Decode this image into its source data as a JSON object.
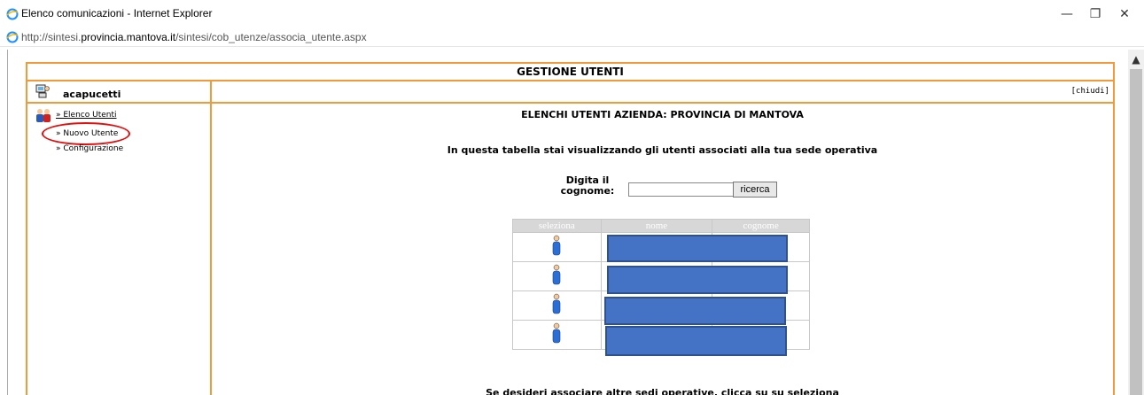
{
  "window": {
    "title": "Elenco comunicazioni - Internet Explorer",
    "url_prefix": "http://sintesi.",
    "url_domain": "provincia.mantova.it",
    "url_path": "/sintesi/cob_utenze/associa_utente.aspx",
    "minimize": "—",
    "restore": "❐",
    "close": "✕"
  },
  "page": {
    "title": "GESTIONE UTENTI",
    "username": "acapucetti",
    "close_link": "[chiudi]",
    "nav": [
      {
        "label": "» Elenco Utenti"
      },
      {
        "label": "» Nuovo Utente"
      },
      {
        "label": "» Configurazione"
      }
    ],
    "heading": "ELENCHI UTENTI AZIENDA: PROVINCIA DI MANTOVA",
    "info": "In questa tabella stai visualizzando gli utenti associati alla tua sede operativa",
    "search_label": "Digita il cognome:",
    "search_button": "ricerca",
    "table": {
      "headers": [
        "seleziona",
        "nome",
        "cognome"
      ],
      "rows": [
        {
          "icon": "user-icon",
          "nome": "",
          "cognome": ""
        },
        {
          "icon": "user-icon",
          "nome": "",
          "cognome": ""
        },
        {
          "icon": "user-icon",
          "nome": "",
          "cognome": ""
        },
        {
          "icon": "user-icon",
          "nome": "",
          "cognome": ""
        }
      ]
    },
    "footer": "Se desideri associare altre sedi operative, clicca su su seleziona"
  },
  "colors": {
    "frame_border": "#f29a3a",
    "highlight_circle": "#e01010",
    "redaction": "#4472c4"
  }
}
